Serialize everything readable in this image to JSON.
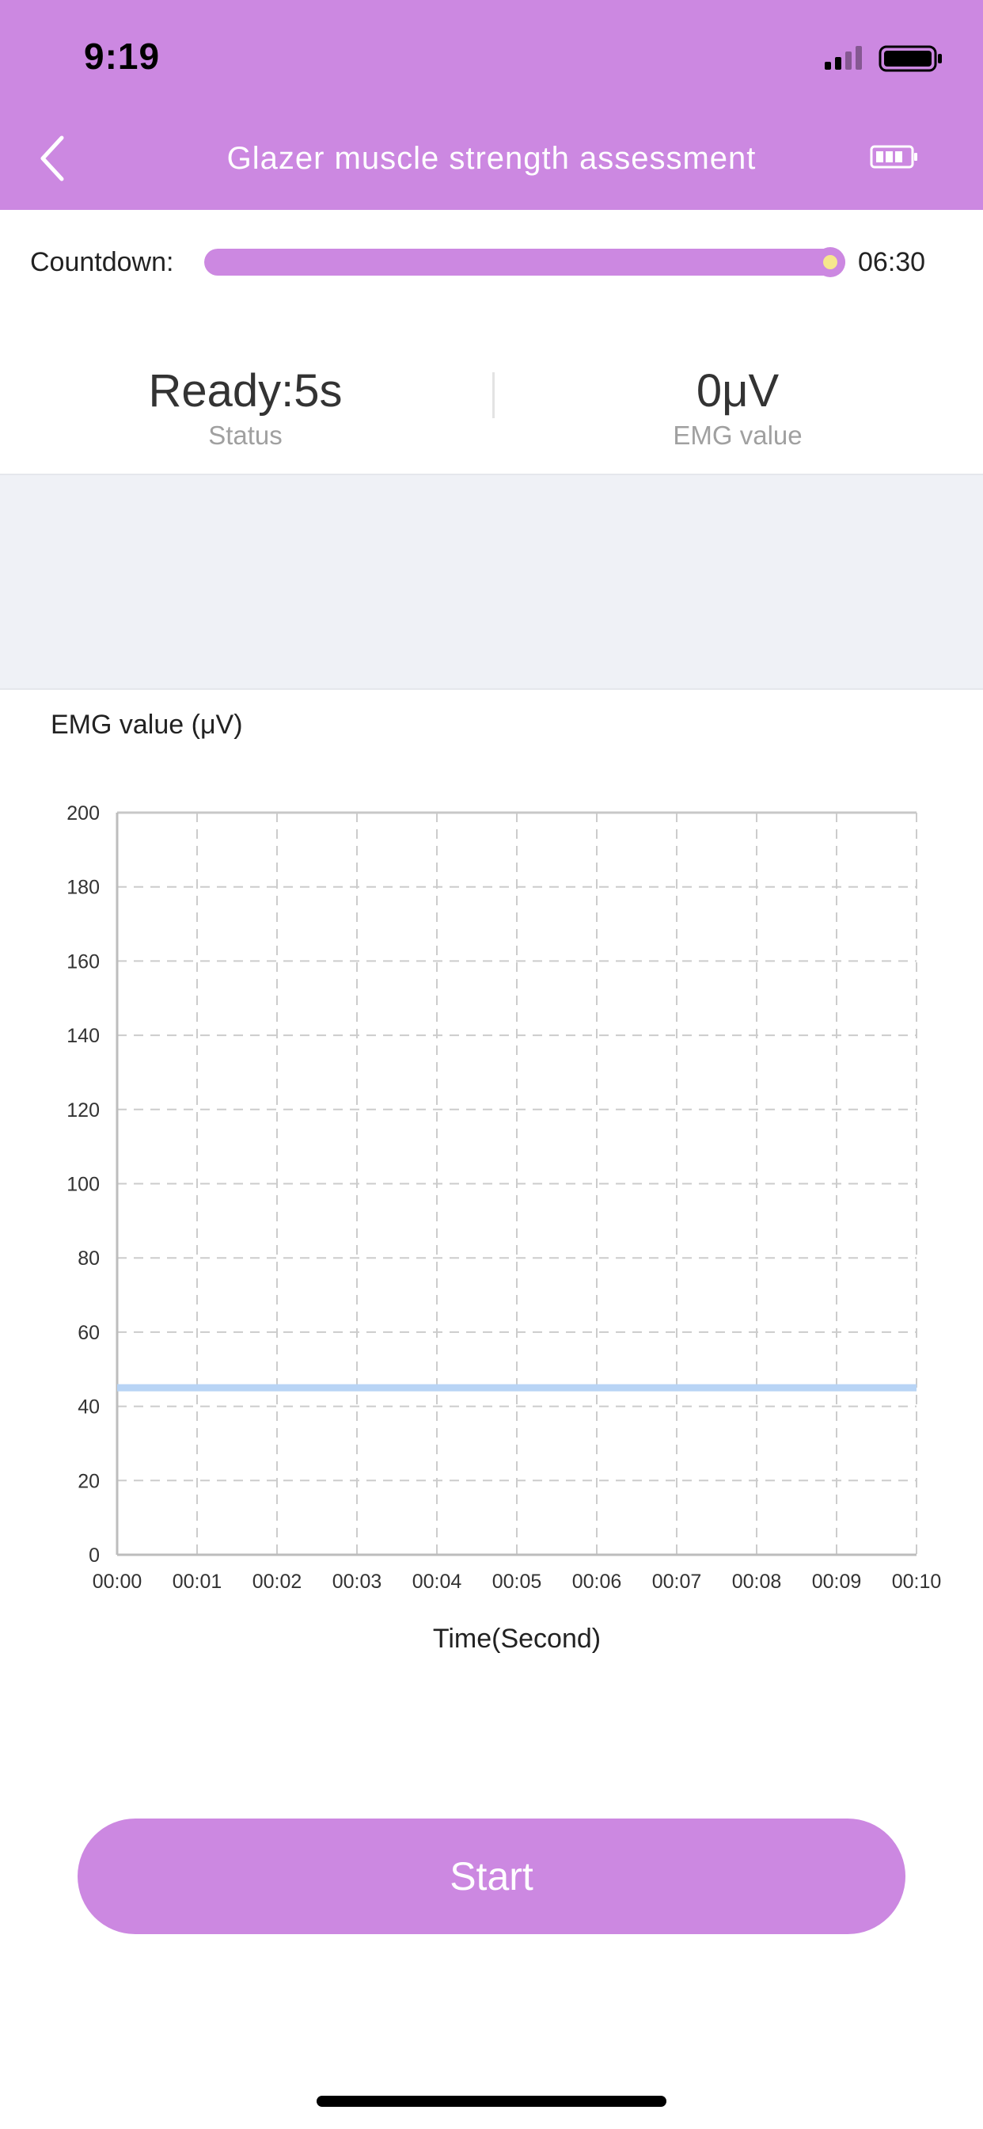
{
  "status_bar": {
    "time": "9:19",
    "signal_icon": "signal-icon",
    "battery_icon": "battery-icon"
  },
  "nav": {
    "title": "Glazer muscle strength assessment",
    "back_icon": "back-chevron-icon",
    "device_battery_icon": "device-battery-icon"
  },
  "countdown": {
    "label": "Countdown:",
    "time": "06:30",
    "progress": 1.0
  },
  "stats": {
    "status_value": "Ready:5s",
    "status_label": "Status",
    "emg_value": "0μV",
    "emg_label": "EMG value"
  },
  "colors": {
    "accent": "#cc88e1",
    "series": "#b8d4f5",
    "grid": "#cccccc",
    "band": "#eff1f6"
  },
  "chart_data": {
    "type": "line",
    "title": "EMG value (μV)",
    "xlabel": "Time(Second)",
    "ylabel": "",
    "x_ticks": [
      "00:00",
      "00:01",
      "00:02",
      "00:03",
      "00:04",
      "00:05",
      "00:06",
      "00:07",
      "00:08",
      "00:09",
      "00:10"
    ],
    "y_ticks": [
      0,
      20,
      40,
      60,
      80,
      100,
      120,
      140,
      160,
      180,
      200
    ],
    "xlim": [
      0,
      10
    ],
    "ylim": [
      0,
      200
    ],
    "grid": true,
    "series": [
      {
        "x": [
          0,
          10
        ],
        "y": [
          45,
          45
        ]
      }
    ]
  },
  "start_button": {
    "label": "Start"
  }
}
